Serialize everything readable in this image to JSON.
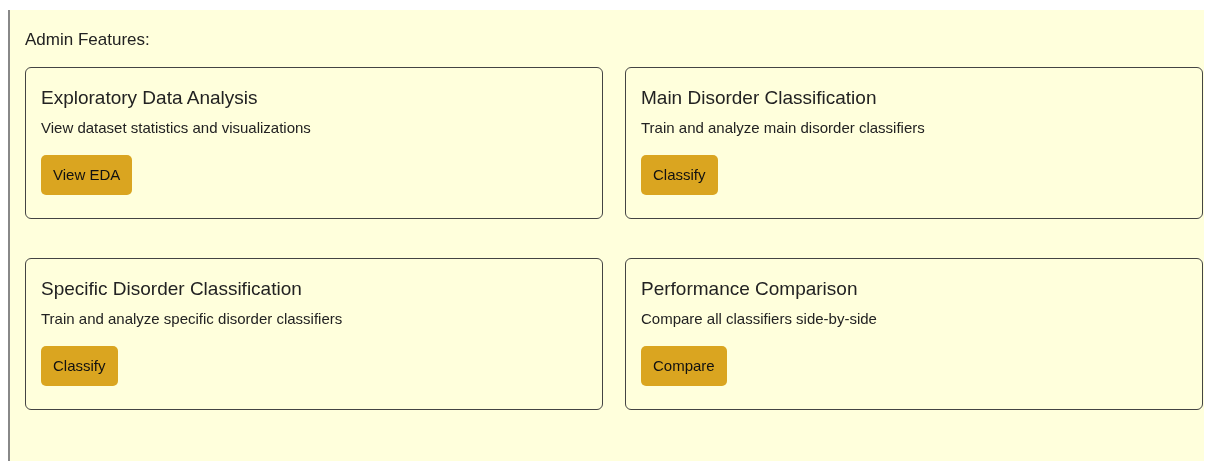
{
  "section_title": "Admin Features:",
  "features": [
    {
      "title": "Exploratory Data Analysis",
      "description": "View dataset statistics and visualizations",
      "button": "View EDA"
    },
    {
      "title": "Main Disorder Classification",
      "description": "Train and analyze main disorder classifiers",
      "button": "Classify"
    },
    {
      "title": "Specific Disorder Classification",
      "description": "Train and analyze specific disorder classifiers",
      "button": "Classify"
    },
    {
      "title": "Performance Comparison",
      "description": "Compare all classifiers side-by-side",
      "button": "Compare"
    }
  ]
}
